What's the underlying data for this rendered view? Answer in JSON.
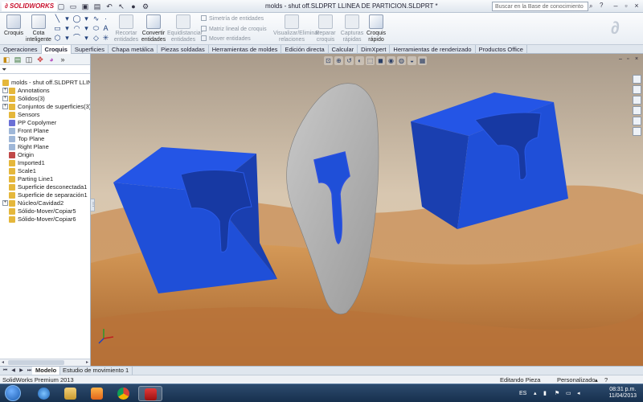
{
  "app": {
    "brand": "SOLIDWORKS",
    "document_title": "molds - shut off.SLDPRT LLINEA DE PARTICION.SLDPRT *",
    "search_placeholder": "Buscar en la Base de conocimiento",
    "help_label": "?"
  },
  "commands": {
    "croquis": "Croquis",
    "cota": "Cota inteligente",
    "recortar": "Recortar entidades",
    "convertir": "Convertir entidades",
    "equidistanciar": "Equidistanciar entidades",
    "simetria": "Simetría de entidades",
    "matriz": "Matriz lineal de croquis",
    "mover": "Mover entidades",
    "visualizar": "Visualizar/Eliminar relaciones",
    "reparar": "Reparar croquis",
    "capturas": "Capturas rápidas",
    "croquis_rapido": "Croquis rápido"
  },
  "tabs": [
    "Operaciones",
    "Croquis",
    "Superficies",
    "Chapa metálica",
    "Piezas soldadas",
    "Herramientas de moldes",
    "Edición directa",
    "Calcular",
    "DimXpert",
    "Herramientas de renderizado",
    "Productos Office"
  ],
  "active_tab": "Croquis",
  "tree": {
    "root": "molds - shut off.SLDPRT LLINEA D",
    "items": [
      {
        "label": "Annotations",
        "expandable": true,
        "icon_color": "#e5b73b"
      },
      {
        "label": "Sólidos(3)",
        "expandable": true,
        "icon_color": "#e5b73b"
      },
      {
        "label": "Conjuntos de superficies(3)",
        "expandable": true,
        "icon_color": "#e5b73b"
      },
      {
        "label": "Sensors",
        "expandable": false,
        "icon_color": "#e5b73b"
      },
      {
        "label": "PP Copolymer",
        "expandable": false,
        "icon_color": "#6a6fd6"
      },
      {
        "label": "Front Plane",
        "expandable": false,
        "icon_color": "#9fb7d8"
      },
      {
        "label": "Top Plane",
        "expandable": false,
        "icon_color": "#9fb7d8"
      },
      {
        "label": "Right Plane",
        "expandable": false,
        "icon_color": "#9fb7d8"
      },
      {
        "label": "Origin",
        "expandable": false,
        "icon_color": "#c04848"
      },
      {
        "label": "Imported1",
        "expandable": false,
        "icon_color": "#e5b73b"
      },
      {
        "label": "Scale1",
        "expandable": false,
        "icon_color": "#e5b73b"
      },
      {
        "label": "Parting Line1",
        "expandable": false,
        "icon_color": "#e5b73b"
      },
      {
        "label": "Superficie desconectada1",
        "expandable": false,
        "icon_color": "#e5b73b"
      },
      {
        "label": "Superficie de separación1",
        "expandable": false,
        "icon_color": "#e5b73b"
      },
      {
        "label": "Núcleo/Cavidad2",
        "expandable": true,
        "icon_color": "#e5b73b"
      },
      {
        "label": "Sólido-Mover/Copiar5",
        "expandable": false,
        "icon_color": "#e5b73b"
      },
      {
        "label": "Sólido-Mover/Copiar6",
        "expandable": false,
        "icon_color": "#e5b73b"
      }
    ]
  },
  "model_tabs": [
    "Modelo",
    "Estudio de movimiento 1"
  ],
  "active_model_tab": "Modelo",
  "status": {
    "product": "SolidWorks Premium 2013",
    "mode": "Editando Pieza",
    "units": "Personalizado",
    "help": "?"
  },
  "taskbar": {
    "language": "ES",
    "time": "08:31 p.m.",
    "date": "11/04/2013"
  },
  "colors": {
    "mold_blue": "#1f4fd8",
    "parting_surface": "#a8a8a8",
    "selection_blue": "#2a4fe0",
    "sky": "#c9b7a0",
    "sand": "#c98a4e"
  }
}
